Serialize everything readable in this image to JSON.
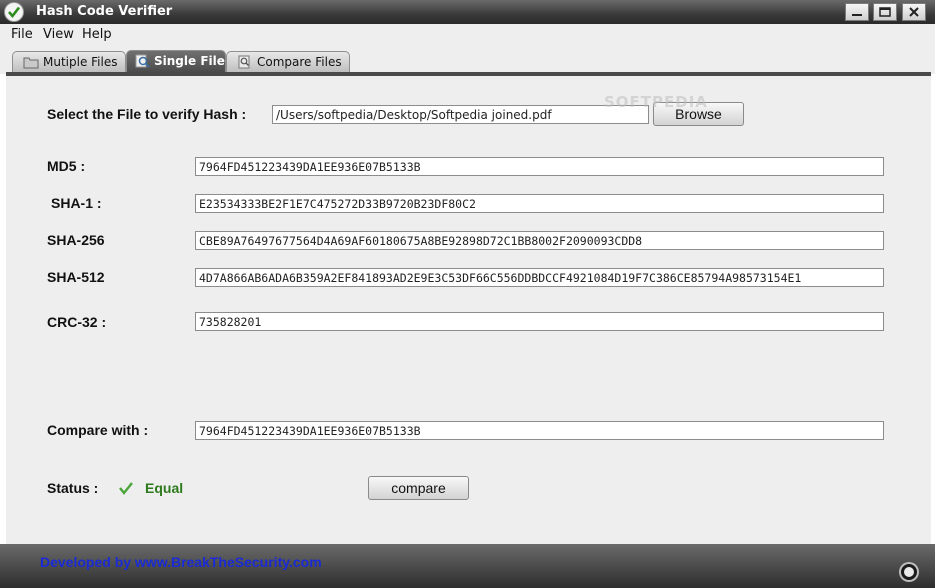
{
  "window": {
    "title": "Hash Code Verifier"
  },
  "menu": [
    "File",
    "View",
    "Help"
  ],
  "tabs": [
    {
      "label": "Mutiple Files",
      "icon": "folder-icon"
    },
    {
      "label": "Single File",
      "icon": "magnifier-icon"
    },
    {
      "label": "Compare Files",
      "icon": "document-search-icon"
    }
  ],
  "active_tab": "Single File",
  "file_select": {
    "label": "Select the File to verify Hash :",
    "path": "/Users/softpedia/Desktop/Softpedia joined.pdf",
    "browse_label": "Browse"
  },
  "watermark": "SOFTPEDIA",
  "hashes": {
    "md5_label": "MD5 :",
    "md5": "7964FD451223439DA1EE936E07B5133B",
    "sha1_label": "SHA-1 :",
    "sha1": "E23534333BE2F1E7C475272D33B9720B23DF80C2",
    "sha256_label": "SHA-256",
    "sha256": "CBE89A76497677564D4A69AF60180675A8BE92898D72C1BB8002F2090093CDD8",
    "sha512_label": "SHA-512",
    "sha512": "4D7A866AB6ADA6B359A2EF841893AD2E9E3C53DF66C556DDBDCCF4921084D19F7C386CE85794A98573154E1",
    "crc32_label": "CRC-32 :",
    "crc32": "735828201"
  },
  "compare": {
    "label": "Compare with :",
    "value": "7964FD451223439DA1EE936E07B5133B",
    "button_label": "compare"
  },
  "status": {
    "label": "Status :",
    "value": "Equal",
    "color": "#2d7a1c"
  },
  "footer": {
    "text": "Developed by www.BreakTheSecurity.com",
    "color": "#1a2bd6"
  }
}
